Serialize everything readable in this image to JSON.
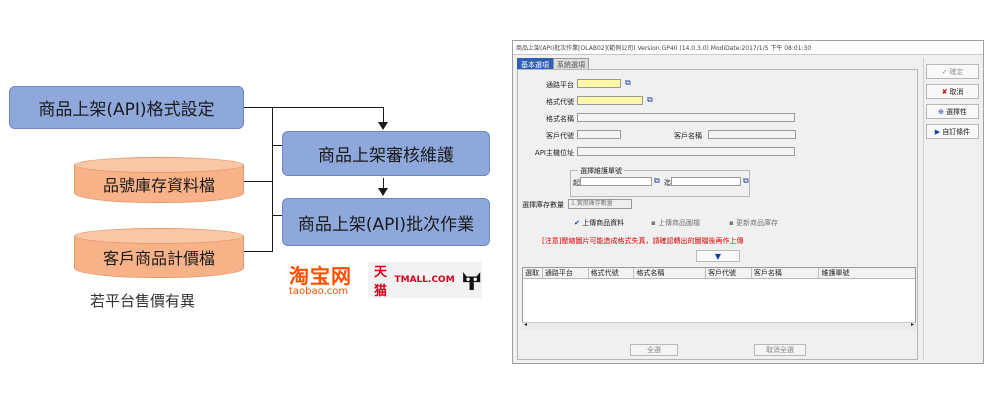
{
  "diagram": {
    "box_api_format": "商品上架(API)格式設定",
    "box_review": "商品上架審核維護",
    "box_batch": "商品上架(API)批次作業",
    "cyl_item_db": "品號庫存資料檔",
    "cyl_price": "客戶商品計價檔",
    "caption": "若平台售價有異",
    "colors": {
      "box": "#8fa8dc",
      "cylinder": "#f7b387"
    }
  },
  "logos": {
    "taobao_cn": "淘宝网",
    "taobao_en": "taobao.com",
    "tmall_cn": "天猫",
    "tmall_en": "TMALL.COM"
  },
  "window": {
    "title": "商品上架(API)批次作業[OLAB02](範例公司) Version:GP40 (14.0.3.0) ModiDate:2017/1/5 下午 08:01:30",
    "tabs": [
      {
        "label": "基本選項",
        "active": true
      },
      {
        "label": "系統選項",
        "active": false
      }
    ],
    "fields": {
      "platform": "通路平台",
      "format_code": "格式代號",
      "format_name": "格式名稱",
      "customer_code": "客戶代號",
      "customer_name": "客戶名稱",
      "api_host": "API主機位址"
    },
    "group": {
      "title": "選擇維護單號",
      "from": "起",
      "to": "迄"
    },
    "stock": {
      "label": "選擇庫存數量",
      "value": "1.實際庫存數量"
    },
    "checks": [
      {
        "label": "上傳商品資料",
        "checked": true
      },
      {
        "label": "上傳商品圖檔",
        "checked": false
      },
      {
        "label": "更新商品庫存",
        "checked": false
      }
    ],
    "warning": "[注意]壓縮圖片可能造成格式失真，請確認轉出的圖檔後再作上傳",
    "down_button": "▼",
    "grid_columns": [
      "選取",
      "通路平台",
      "格式代號",
      "格式名稱",
      "客戶代號",
      "客戶名稱",
      "維護單號"
    ],
    "bottom_buttons": {
      "select_all": "全選",
      "deselect_all": "取消全選"
    },
    "side_buttons": [
      {
        "label": "確定",
        "icon": "✓",
        "enabled": false
      },
      {
        "label": "取消",
        "icon": "✘",
        "enabled": true
      },
      {
        "label": "選擇性",
        "icon": "⊕",
        "enabled": true
      },
      {
        "label": "自訂條件",
        "icon": "▶",
        "enabled": true
      }
    ],
    "picker_icon": "⧉"
  }
}
